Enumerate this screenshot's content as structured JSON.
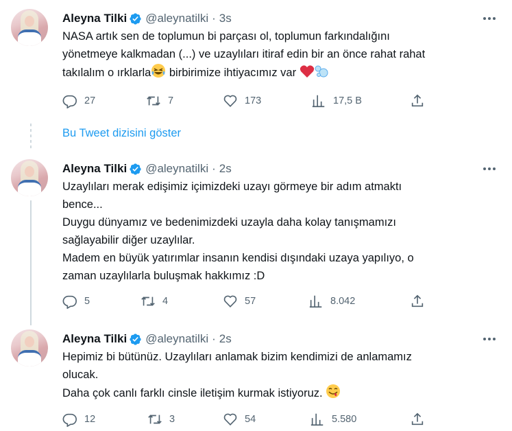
{
  "tweets": [
    {
      "name": "Aleyna Tilki",
      "handle": "@aleynatilki",
      "dot": "·",
      "time": "3s",
      "lines": [
        "NASA artık sen de toplumun bi parçası ol, toplumun farkındalığını",
        "yönetmeye kalkmadan (...) ve uzaylıları itiraf edin bir an önce rahat rahat",
        "takılalım o ırklarla"
      ],
      "line3_after_emoji": " birbirimize ihtiyacımız var ",
      "emojis": [
        "laughing-crying-emoji",
        "red-heart-emoji",
        "bubbles-emoji"
      ],
      "replies": "27",
      "retweets": "7",
      "likes": "173",
      "views": "17,5 B"
    },
    {
      "name": "Aleyna Tilki",
      "handle": "@aleynatilki",
      "dot": "·",
      "time": "2s",
      "lines": [
        "Uzaylıları merak edişimiz içimizdeki uzayı görmeye  bir adım atmaktı",
        "bence...",
        "Duygu dünyamız ve bedenimizdeki uzayla daha kolay tanışmamızı",
        "sağlayabilir diğer uzaylılar.",
        "Madem en büyük yatırımlar insanın kendisi dışındaki uzaya yapılıyo, o",
        "zaman uzaylılarla buluşmak hakkımız :D"
      ],
      "replies": "5",
      "retweets": "4",
      "likes": "57",
      "views": "8.042"
    },
    {
      "name": "Aleyna Tilki",
      "handle": "@aleynatilki",
      "dot": "·",
      "time": "2s",
      "lines": [
        "Hepimiz bi bütünüz. Uzaylıları anlamak bizim kendimizi de anlamamız",
        "olucak.",
        "Daha çok canlı farklı cinsle iletişim kurmak istiyoruz. "
      ],
      "emojis": [
        "yum-face-emoji"
      ],
      "replies": "12",
      "retweets": "3",
      "likes": "54",
      "views": "5.580"
    }
  ],
  "show_thread_label": "Bu Tweet dizisini göster",
  "colors": {
    "accent": "#1d9bf0",
    "text": "#0f1419",
    "muted": "#536471",
    "thread_line": "#cfd9de",
    "verified": "#1d9bf0"
  },
  "icons": [
    "reply-icon",
    "retweet-icon",
    "like-icon",
    "views-icon",
    "share-icon",
    "verified-badge-icon",
    "more-icon"
  ]
}
